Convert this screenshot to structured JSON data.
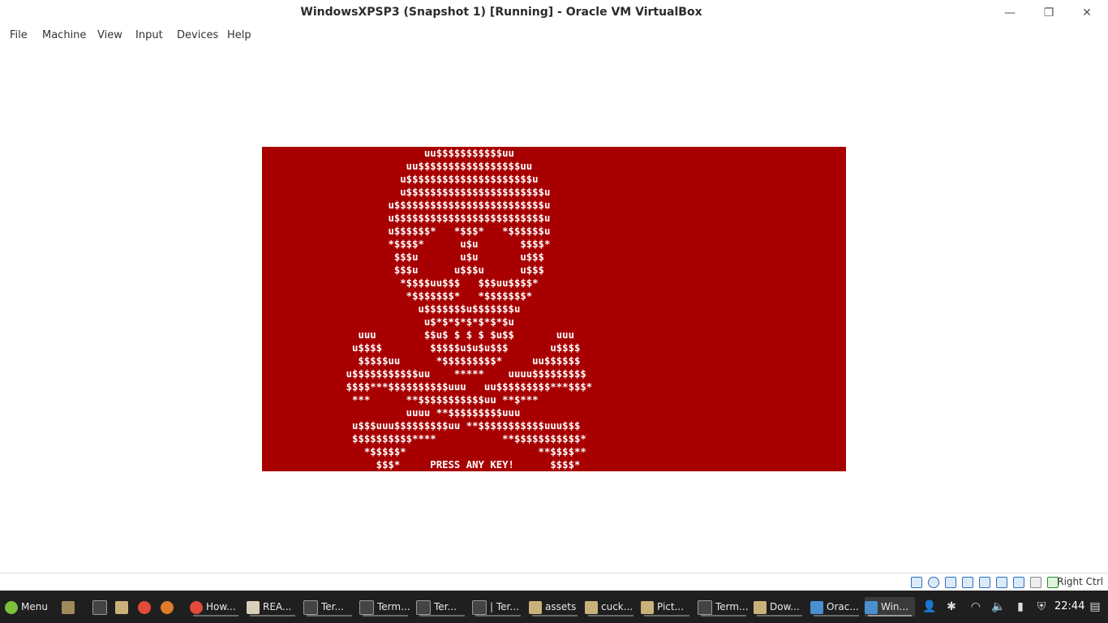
{
  "window": {
    "title": "WindowsXPSP3 (Snapshot 1) [Running] - Oracle VM VirtualBox",
    "minimize_glyph": "—",
    "restore_glyph": "❐",
    "close_glyph": "✕"
  },
  "menu": [
    "File",
    "Machine",
    "View",
    "Input",
    "Devices",
    "Help"
  ],
  "vm_screen": {
    "bg_color": "#a80000",
    "text_color": "#ffffff",
    "ascii_art": "                           uu$$$$$$$$$$$uu\n                        uu$$$$$$$$$$$$$$$$$uu\n                       u$$$$$$$$$$$$$$$$$$$$$u\n                       u$$$$$$$$$$$$$$$$$$$$$$$u\n                     u$$$$$$$$$$$$$$$$$$$$$$$$$u\n                     u$$$$$$$$$$$$$$$$$$$$$$$$$u\n                     u$$$$$$*   *$$$*   *$$$$$$u\n                     *$$$$*      u$u       $$$$*\n                      $$$u       u$u       u$$$\n                      $$$u      u$$$u      u$$$\n                       *$$$$uu$$$   $$$uu$$$$*\n                        *$$$$$$$*   *$$$$$$$*\n                          u$$$$$$$u$$$$$$$u\n                           u$*$*$*$*$*$*$u\n                uuu        $$u$ $ $ $ $u$$       uuu\n               u$$$$        $$$$$u$u$u$$$       u$$$$\n                $$$$$uu      *$$$$$$$$$*     uu$$$$$$\n              u$$$$$$$$$$$uu    *****    uuuu$$$$$$$$$\n              $$$$***$$$$$$$$$$uuu   uu$$$$$$$$$***$$$*\n               ***      **$$$$$$$$$$$uu **$***\n                        uuuu **$$$$$$$$$uuu\n               u$$$uuu$$$$$$$$$uu **$$$$$$$$$$$uuu$$$\n               $$$$$$$$$$****           **$$$$$$$$$$$*\n                 *$$$$$*                      **$$$$**\n                   $$$*     PRESS ANY KEY!      $$$$*"
  },
  "statusbar": {
    "host_key": "Right Ctrl",
    "icons": [
      "hard-disk-icon",
      "optical-drive-icon",
      "audio-icon",
      "network-icon",
      "usb-icon",
      "shared-folders-icon",
      "display-icon",
      "video-capture-icon",
      "mouse-integration-icon",
      "cpu-icon"
    ]
  },
  "taskbar": {
    "menu_label": "Menu",
    "windows": [
      {
        "label": "How...",
        "icon": "chrome-icon"
      },
      {
        "label": "REA...",
        "icon": "document-icon"
      },
      {
        "label": "Ter...",
        "icon": "terminal-icon"
      },
      {
        "label": "Term...",
        "icon": "terminal-icon"
      },
      {
        "label": "Ter...",
        "icon": "terminal-icon"
      },
      {
        "label": "| Ter...",
        "icon": "terminal-icon"
      },
      {
        "label": "assets",
        "icon": "folder-icon"
      },
      {
        "label": "cuck...",
        "icon": "folder-icon"
      },
      {
        "label": "Pict...",
        "icon": "folder-icon"
      },
      {
        "label": "Term...",
        "icon": "terminal-icon"
      },
      {
        "label": "Dow...",
        "icon": "folder-icon"
      },
      {
        "label": "Orac...",
        "icon": "virtualbox-icon"
      },
      {
        "label": "Win...",
        "icon": "virtualbox-icon"
      }
    ],
    "clock": "22:44"
  }
}
